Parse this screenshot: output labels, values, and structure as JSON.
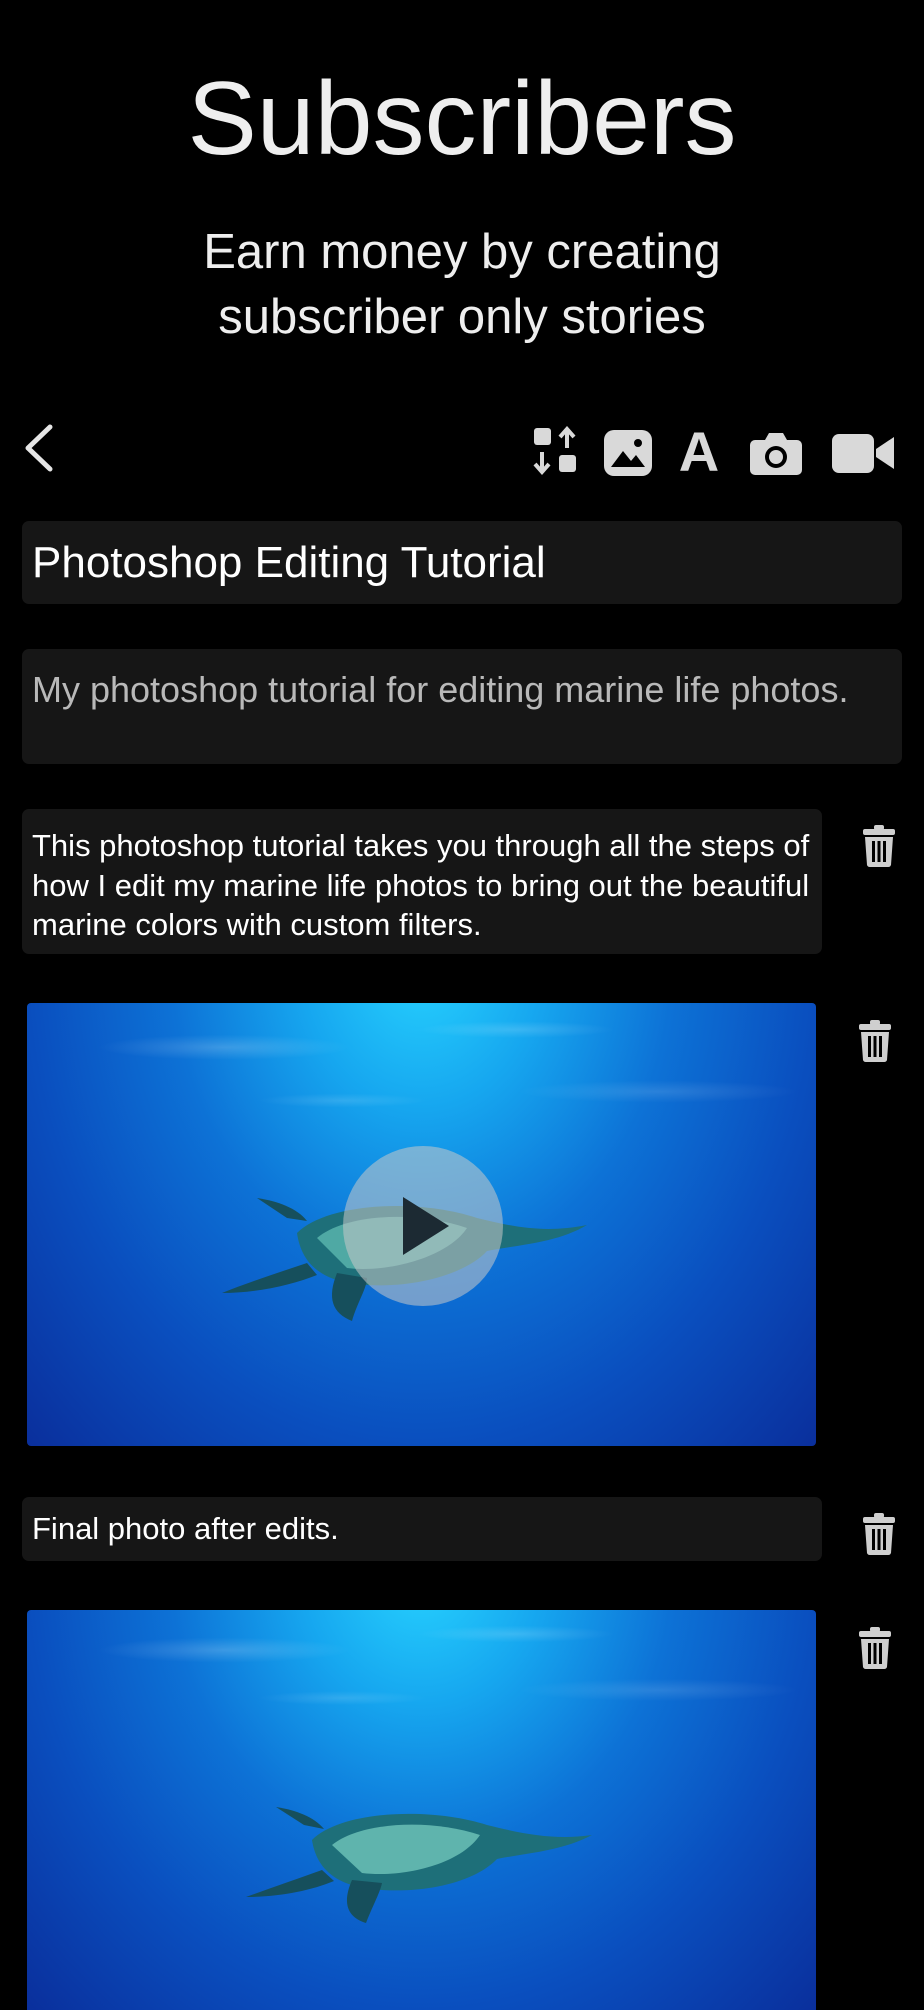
{
  "header": {
    "title": "Subscribers",
    "subtitle_line1": "Earn money by creating",
    "subtitle_line2": "subscriber only stories"
  },
  "toolbar": {
    "back_icon": "chevron-left-icon",
    "items": [
      {
        "name": "reorder-icon"
      },
      {
        "name": "photo-icon"
      },
      {
        "name": "text-icon",
        "glyph": "A"
      },
      {
        "name": "camera-icon"
      },
      {
        "name": "video-icon"
      }
    ]
  },
  "form": {
    "title_value": "Photoshop Editing Tutorial",
    "subtitle_value": "My photoshop tutorial for editing marine life photos."
  },
  "blocks": {
    "text_1": "This photoshop tutorial takes you through all the steps of how I edit my marine life photos to bring out the beautiful marine colors with custom filters.",
    "caption_1": "Final photo after edits."
  },
  "colors": {
    "background": "#000000",
    "field_bg": "#161616",
    "icon": "#d9d9d9"
  }
}
